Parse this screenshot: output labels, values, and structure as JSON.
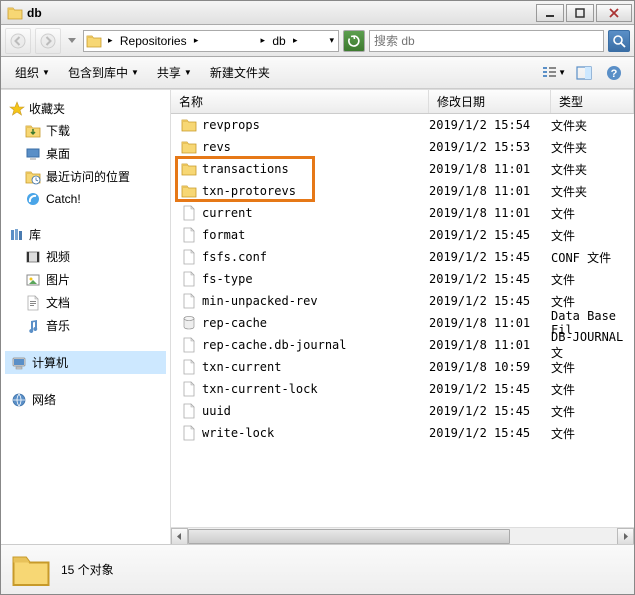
{
  "window": {
    "title": "db"
  },
  "breadcrumb": {
    "seg1": "Repositories",
    "seg2": "db"
  },
  "search": {
    "placeholder": "搜索 db"
  },
  "toolbar": {
    "organize": "组织",
    "include": "包含到库中",
    "share": "共享",
    "newfolder": "新建文件夹"
  },
  "sidebar": {
    "fav": "收藏夹",
    "downloads": "下载",
    "desktop": "桌面",
    "recent": "最近访问的位置",
    "catch": "Catch!",
    "lib": "库",
    "videos": "视频",
    "pictures": "图片",
    "docs": "文档",
    "music": "音乐",
    "computer": "计算机",
    "network": "网络"
  },
  "columns": {
    "name": "名称",
    "date": "修改日期",
    "type": "类型"
  },
  "files": [
    {
      "icon": "folder",
      "name": "revprops",
      "date": "2019/1/2 15:54",
      "type": "文件夹"
    },
    {
      "icon": "folder",
      "name": "revs",
      "date": "2019/1/2 15:53",
      "type": "文件夹"
    },
    {
      "icon": "folder",
      "name": "transactions",
      "date": "2019/1/8 11:01",
      "type": "文件夹"
    },
    {
      "icon": "folder",
      "name": "txn-protorevs",
      "date": "2019/1/8 11:01",
      "type": "文件夹"
    },
    {
      "icon": "file",
      "name": "current",
      "date": "2019/1/8 11:01",
      "type": "文件"
    },
    {
      "icon": "file",
      "name": "format",
      "date": "2019/1/2 15:45",
      "type": "文件"
    },
    {
      "icon": "file",
      "name": "fsfs.conf",
      "date": "2019/1/2 15:45",
      "type": "CONF 文件"
    },
    {
      "icon": "file",
      "name": "fs-type",
      "date": "2019/1/2 15:45",
      "type": "文件"
    },
    {
      "icon": "file",
      "name": "min-unpacked-rev",
      "date": "2019/1/2 15:45",
      "type": "文件"
    },
    {
      "icon": "db",
      "name": "rep-cache",
      "date": "2019/1/8 11:01",
      "type": "Data Base Fil"
    },
    {
      "icon": "file",
      "name": "rep-cache.db-journal",
      "date": "2019/1/8 11:01",
      "type": "DB-JOURNAL 文"
    },
    {
      "icon": "file",
      "name": "txn-current",
      "date": "2019/1/8 10:59",
      "type": "文件"
    },
    {
      "icon": "file",
      "name": "txn-current-lock",
      "date": "2019/1/2 15:45",
      "type": "文件"
    },
    {
      "icon": "file",
      "name": "uuid",
      "date": "2019/1/2 15:45",
      "type": "文件"
    },
    {
      "icon": "file",
      "name": "write-lock",
      "date": "2019/1/2 15:45",
      "type": "文件"
    }
  ],
  "status": {
    "count": "15 个对象"
  }
}
